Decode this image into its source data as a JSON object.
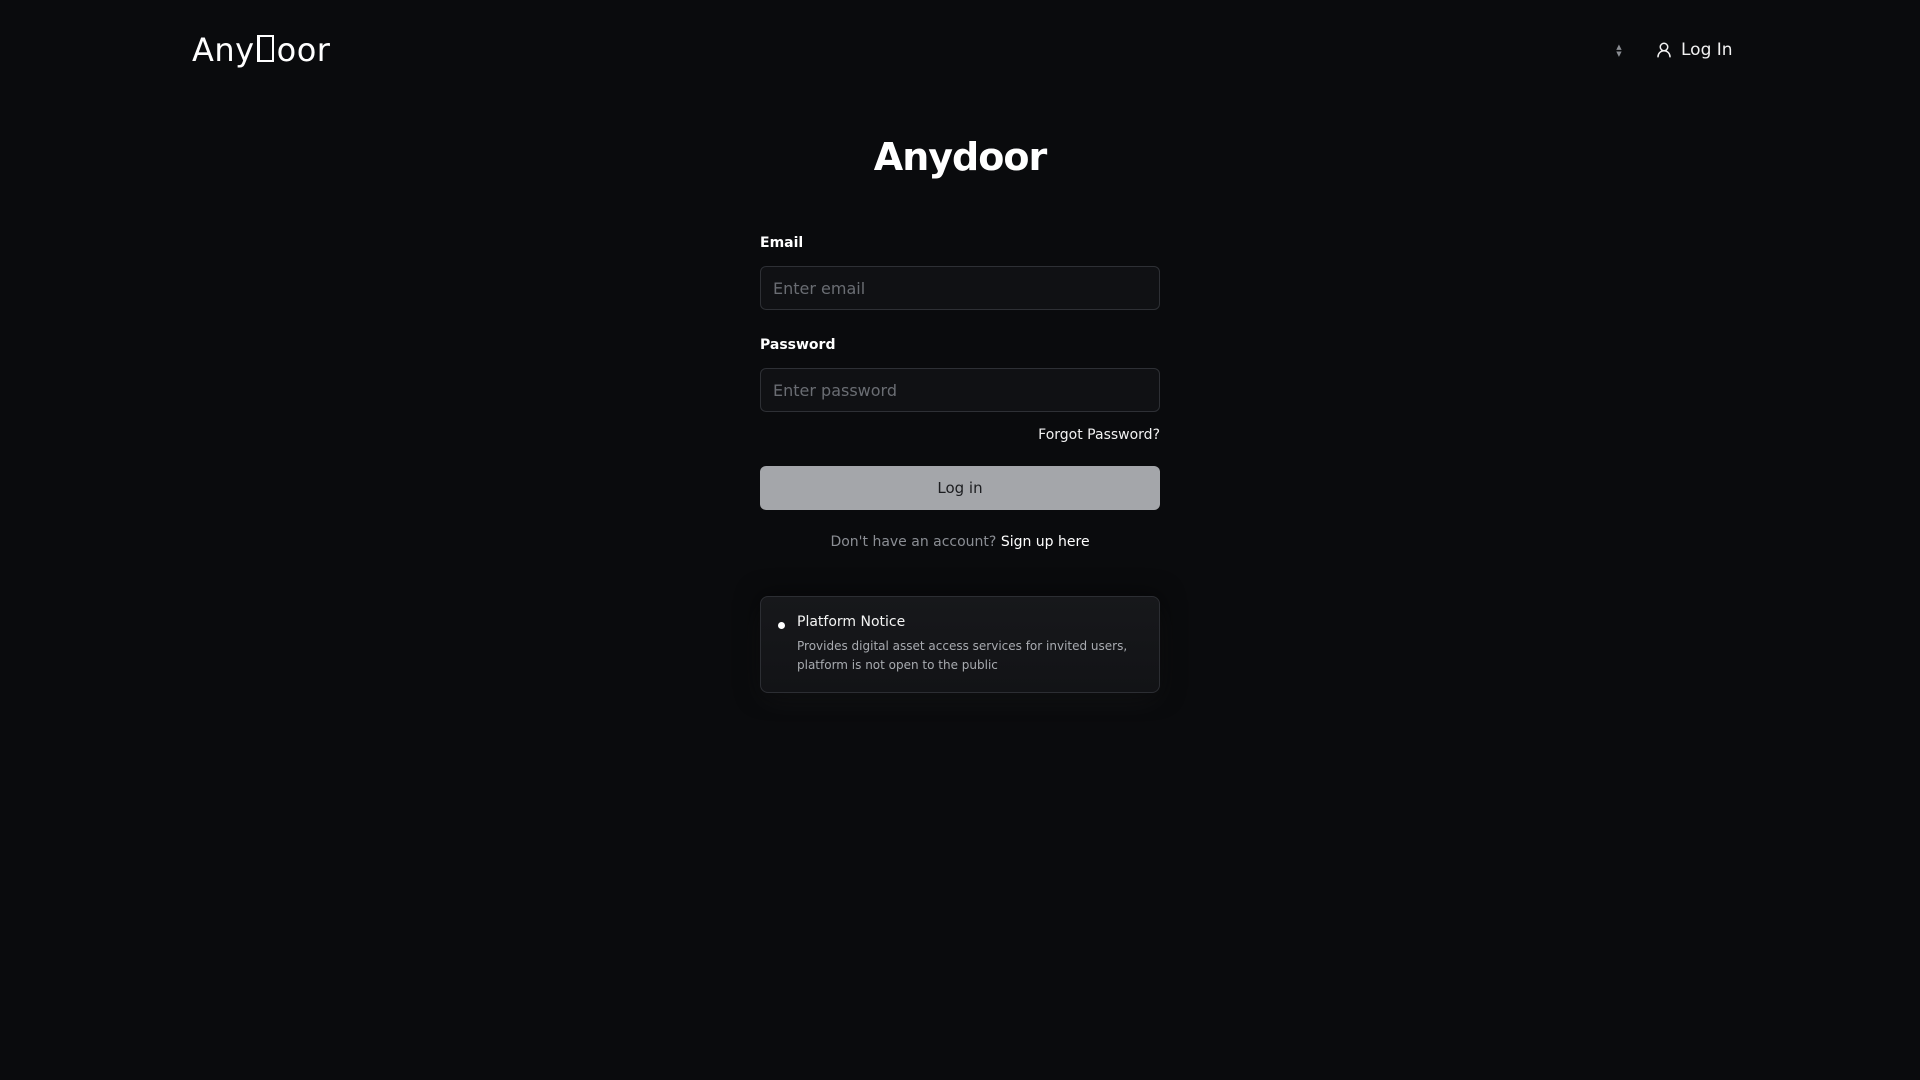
{
  "header": {
    "logo_left": "Any",
    "logo_right": "oor",
    "lang_icon": "chevron-up-down-icon",
    "login_icon": "user-icon",
    "login_label": "Log In"
  },
  "main": {
    "title": "Anydoor",
    "email": {
      "label": "Email",
      "value": "",
      "placeholder": "Enter email"
    },
    "password": {
      "label": "Password",
      "value": "",
      "placeholder": "Enter password"
    },
    "forgot_label": "Forgot Password?",
    "submit_label": "Log in",
    "signup_prompt": "Don't have an account?",
    "signup_link": "Sign up here"
  },
  "notice": {
    "title": "Platform Notice",
    "text": "Provides digital asset access services for invited users, platform is not open to the public"
  },
  "colors": {
    "background": "#0a0b0d",
    "button": "#a4a6aa",
    "input_border": "#2e3035"
  }
}
